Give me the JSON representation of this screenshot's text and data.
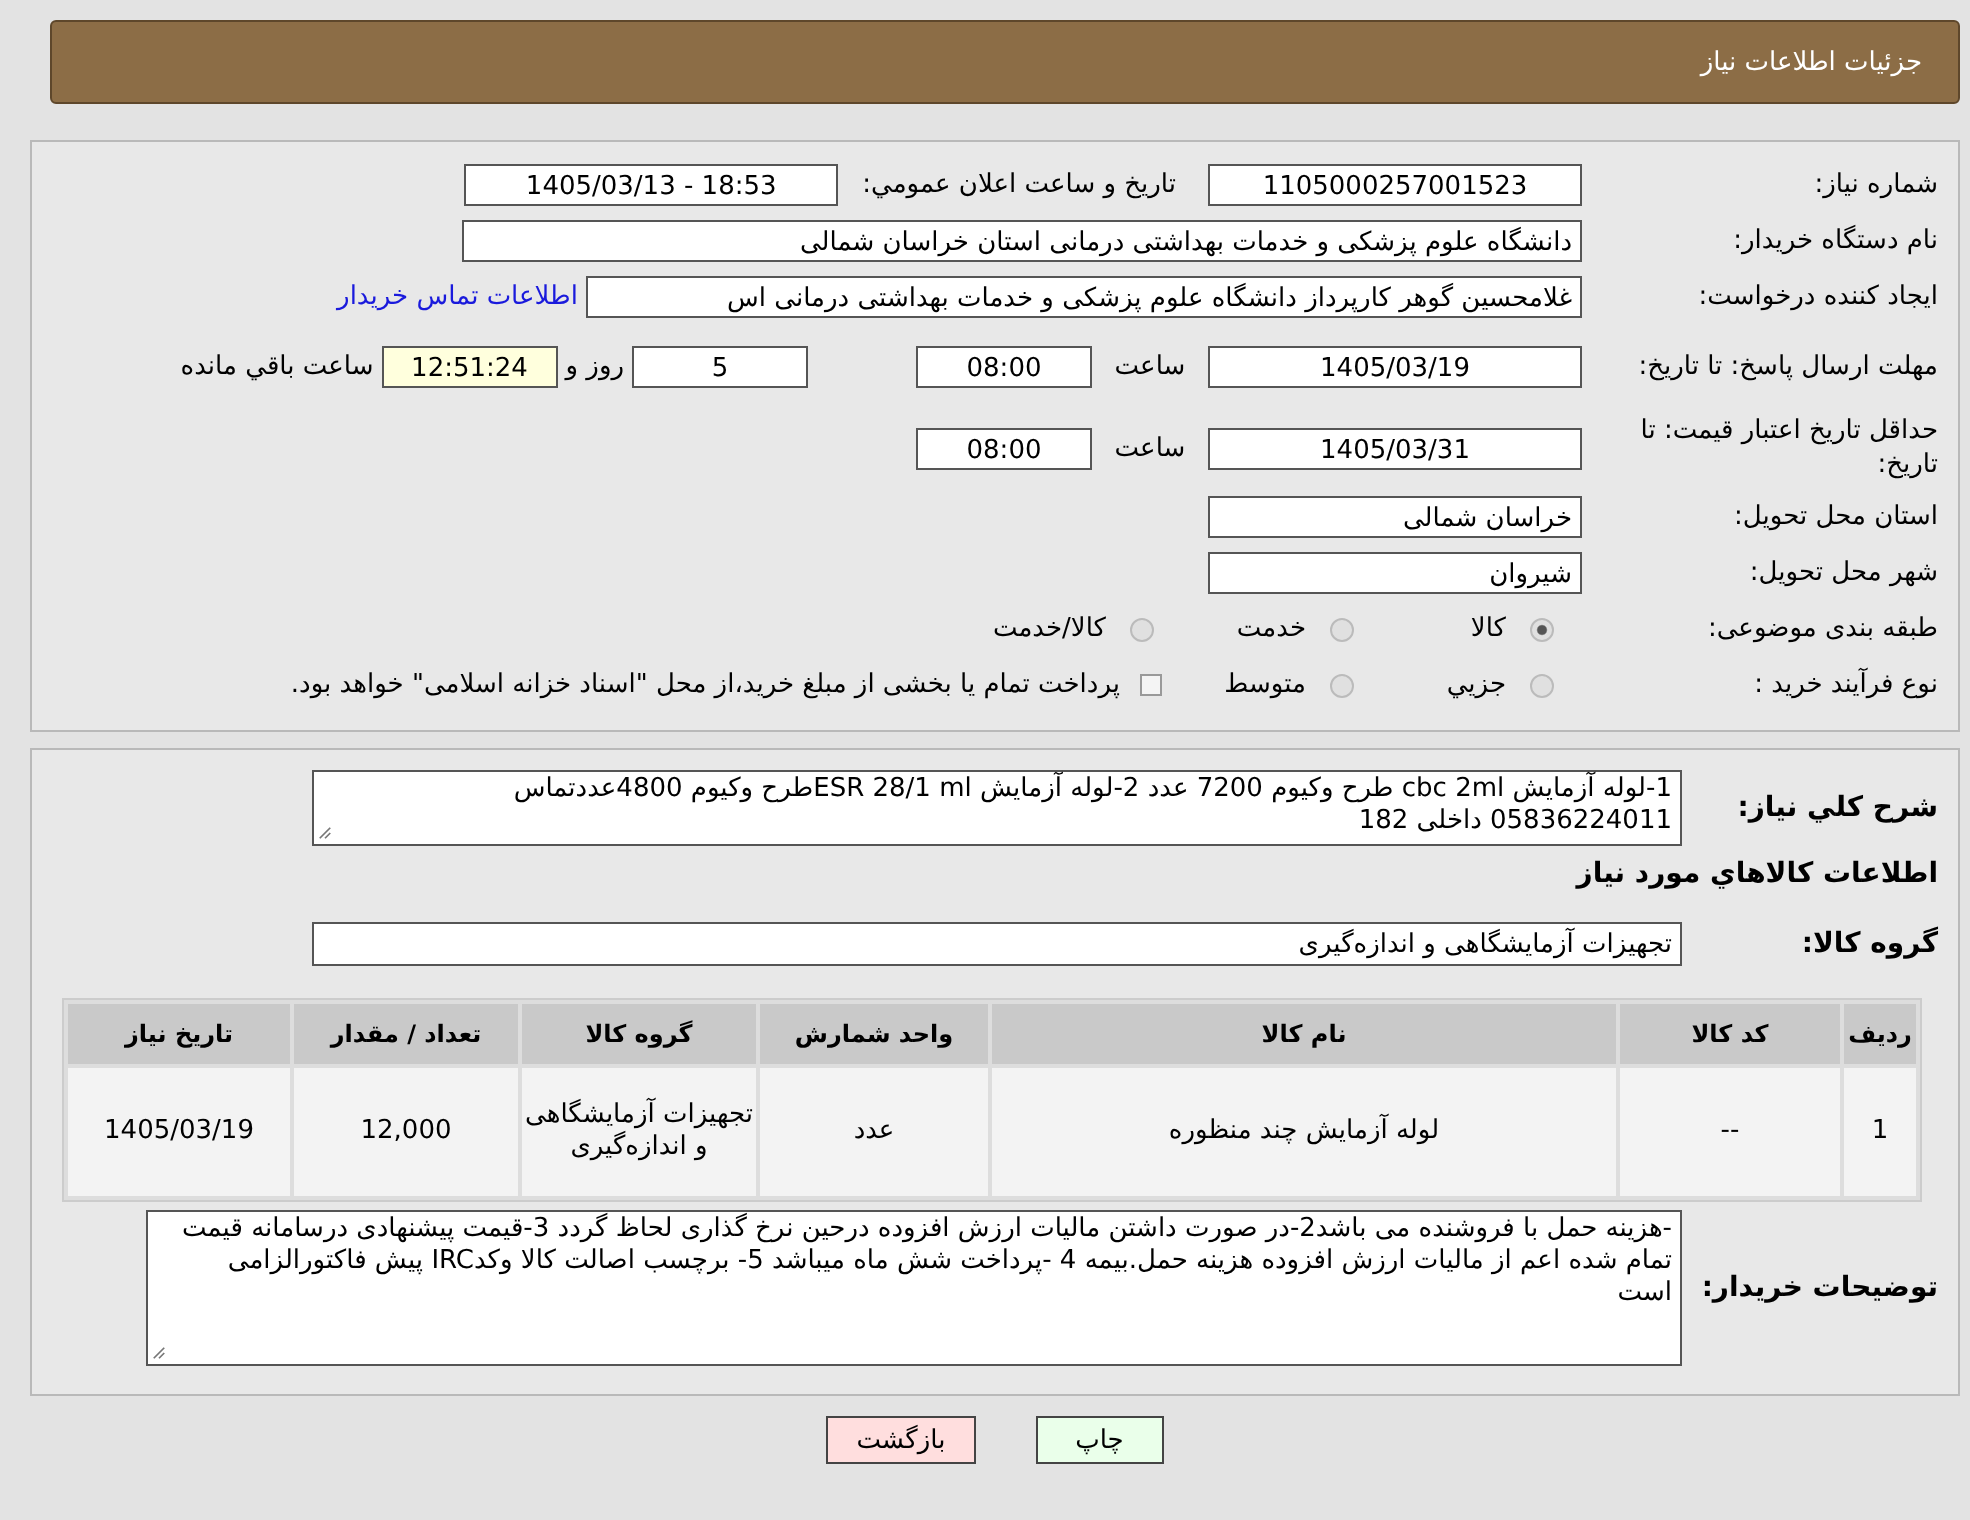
{
  "header": {
    "title": "جزئیات اطلاعات نیاز"
  },
  "need_number": {
    "label": "شماره نیاز:",
    "value": "1105000257001523"
  },
  "announce": {
    "label": "تاریخ و ساعت اعلان عمومي:",
    "value": "1405/03/13 - 18:53"
  },
  "buyer_org": {
    "label": "نام دستگاه خريدار:",
    "value": "دانشگاه علوم پزشکی و خدمات بهداشتی درمانی استان خراسان شمالی"
  },
  "requester": {
    "label": "ایجاد کننده درخواست:",
    "value": "غلامحسین گوهر کارپرداز  دانشگاه علوم پزشکی و خدمات بهداشتی درمانی اس",
    "link": "اطلاعات تماس خريدار"
  },
  "reply_deadline": {
    "label": "مهلت ارسال پاسخ: تا تاریخ:",
    "date": "1405/03/19",
    "time_label": "ساعت",
    "time": "08:00",
    "days": "5",
    "days_label": "روز و",
    "remaining": "12:51:24",
    "remaining_label": "ساعت باقي مانده"
  },
  "price_validity": {
    "label": "حداقل تاريخ اعتبار قيمت: تا تاريخ:",
    "date": "1405/03/31",
    "time_label": "ساعت",
    "time": "08:00"
  },
  "province": {
    "label": "استان محل تحویل:",
    "value": "خراسان شمالی"
  },
  "city": {
    "label": "شهر محل تحویل:",
    "value": "شیروان"
  },
  "category": {
    "label": "طبقه بندی موضوعی:",
    "options": [
      {
        "label": "کالا",
        "selected": true
      },
      {
        "label": "خدمت",
        "selected": false
      },
      {
        "label": "کالا/خدمت",
        "selected": false
      }
    ]
  },
  "process": {
    "label": "نوع فرآیند خرید :",
    "options": [
      {
        "label": "جزيي",
        "selected": false
      },
      {
        "label": "متوسط",
        "selected": false
      }
    ],
    "payment_note": {
      "text": "پرداخت تمام یا بخشی از مبلغ خرید،از محل \"اسناد خزانه اسلامی\" خواهد بود.",
      "checked": false
    }
  },
  "description": {
    "label": "شرح کلي نياز:",
    "value": "1-لوله آزمایش cbc 2ml طرح وکیوم 7200 عدد 2-لوله آزمایش ESR 28/1 mlطرح وکیوم 4800عددتماس 05836224011 داخلی 182"
  },
  "items_heading": "اطلاعات کالاهاي مورد نياز",
  "goods_group": {
    "label": "گروه کالا:",
    "value": "تجهیزات آزمایشگاهی و اندازه‌گیری"
  },
  "table": {
    "columns": [
      "ردیف",
      "کد کالا",
      "نام کالا",
      "واحد شمارش",
      "گروه کالا",
      "تعداد / مقدار",
      "تاریخ نیاز"
    ],
    "rows": [
      [
        "1",
        "--",
        "لوله آزمایش چند منظوره",
        "عدد",
        "تجهیزات آزمایشگاهی و اندازه‌گیری",
        "12,000",
        "1405/03/19"
      ]
    ]
  },
  "buyer_notes": {
    "label": "توضیحات خریدار:",
    "value": "-هزینه حمل با فروشنده می باشد2-در صورت داشتن مالیات ارزش افزوده درحین نرخ گذاری لحاظ گردد 3-قیمت پیشنهادی درسامانه  قیمت تمام شده اعم از مالیات ارزش افزوده هزینه حمل.بیمه  4 -پرداخت شش ماه میباشد 5- برچسب اصالت کالا وکدIRC پیش فاکتورالزامی است"
  },
  "buttons": [
    {
      "label": "چاپ",
      "kind": "print"
    },
    {
      "label": "بازگشت",
      "kind": "back"
    }
  ]
}
